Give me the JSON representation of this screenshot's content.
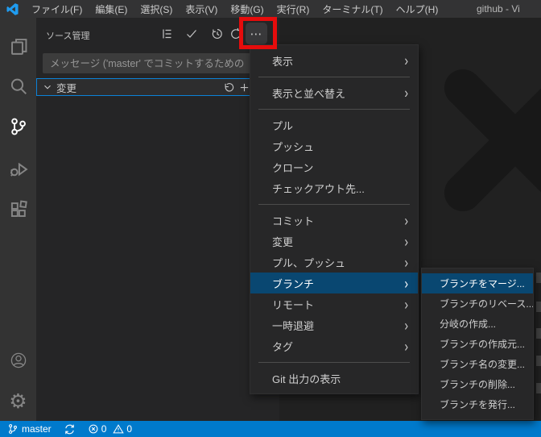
{
  "title_bar": {
    "menus": [
      "ファイル(F)",
      "編集(E)",
      "選択(S)",
      "表示(V)",
      "移動(G)",
      "実行(R)",
      "ターミナル(T)",
      "ヘルプ(H)"
    ],
    "window_title": "github - Vi"
  },
  "activity_bar": {
    "items": [
      "explorer-icon",
      "search-icon",
      "source-control-icon",
      "run-debug-icon",
      "extensions-icon",
      "account-icon",
      "settings-gear-icon"
    ],
    "active_item": "source-control-icon"
  },
  "sidebar": {
    "header": "ソース管理",
    "toolbar_icons": [
      "list-tree-icon",
      "commit-check-icon",
      "history-icon",
      "refresh-icon",
      "more-actions-icon"
    ],
    "commit_input": {
      "value": "",
      "placeholder": "メッセージ ('master' でコミットするための"
    },
    "changes_section": {
      "label": "変更",
      "icons": [
        "discard-icon",
        "stage-all-plus-icon"
      ]
    }
  },
  "icons": {
    "more": "⋯",
    "submenu_arrow": "›"
  },
  "context_menu": {
    "items": [
      {
        "label": "表示",
        "submenu": true
      },
      {
        "type": "separator"
      },
      {
        "label": "表示と並べ替え",
        "submenu": true
      },
      {
        "type": "separator"
      },
      {
        "label": "プル"
      },
      {
        "label": "プッシュ"
      },
      {
        "label": "クローン"
      },
      {
        "label": "チェックアウト先..."
      },
      {
        "type": "separator"
      },
      {
        "label": "コミット",
        "submenu": true
      },
      {
        "label": "変更",
        "submenu": true
      },
      {
        "label": "プル、プッシュ",
        "submenu": true
      },
      {
        "label": "ブランチ",
        "submenu": true,
        "active": true
      },
      {
        "label": "リモート",
        "submenu": true
      },
      {
        "label": "一時退避",
        "submenu": true
      },
      {
        "label": "タグ",
        "submenu": true
      },
      {
        "type": "separator"
      },
      {
        "label": "Git 出力の表示"
      }
    ]
  },
  "branch_submenu": {
    "items": [
      {
        "label": "ブランチをマージ...",
        "active": true
      },
      {
        "label": "ブランチのリベース..."
      },
      {
        "label": "分岐の作成..."
      },
      {
        "label": "ブランチの作成元..."
      },
      {
        "label": "ブランチ名の変更..."
      },
      {
        "label": "ブランチの削除..."
      },
      {
        "label": "ブランチを発行..."
      }
    ]
  },
  "status_bar": {
    "branch": "master",
    "errors": "0",
    "warnings": "0"
  },
  "colors": {
    "status_bar": "#007acc",
    "menu_highlight": "#094771",
    "focus_border": "#0b82d8",
    "annotation_red": "#e60c0c",
    "logo_blue": "#1f9cf0"
  }
}
